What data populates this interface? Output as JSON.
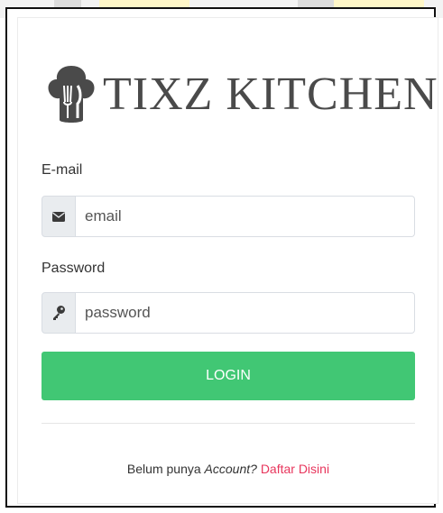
{
  "brand": {
    "name": "TIXZ KITCHEN",
    "text_color": "#4a4a4a"
  },
  "form": {
    "email_label": "E-mail",
    "email_placeholder": "email",
    "email_icon": "envelope-icon",
    "password_label": "Password",
    "password_placeholder": "password",
    "password_icon": "key-icon"
  },
  "login_button": {
    "label": "LOGIN",
    "color": "#41c774"
  },
  "footer": {
    "prefix": "Belum punya ",
    "account_word": "Account",
    "question_mark": "? ",
    "register_link": "Daftar Disini",
    "link_color": "#e8365d"
  }
}
